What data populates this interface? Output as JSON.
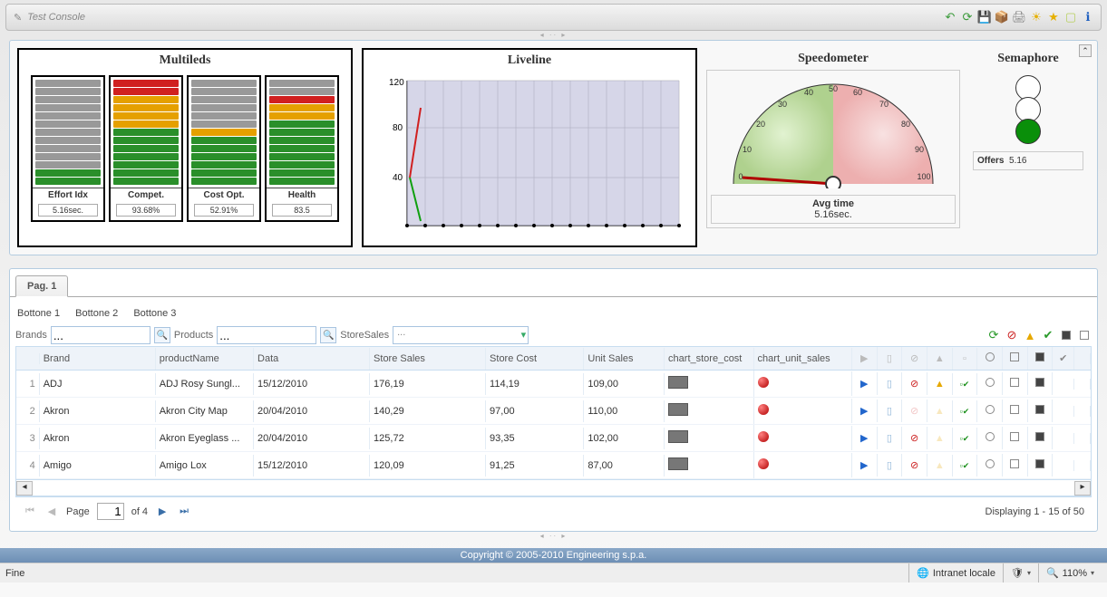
{
  "app_title": "Test Console",
  "dashboard": {
    "multileds": {
      "title": "Multileds",
      "cols": [
        {
          "label": "Effort Idx",
          "value": "5.16sec.",
          "colors": [
            "gray",
            "gray",
            "gray",
            "gray",
            "gray",
            "gray",
            "gray",
            "gray",
            "gray",
            "gray",
            "gray",
            "green",
            "green"
          ]
        },
        {
          "label": "Compet.",
          "value": "93.68%",
          "colors": [
            "red",
            "red",
            "orange",
            "orange",
            "orange",
            "orange",
            "green",
            "green",
            "green",
            "green",
            "green",
            "green",
            "green"
          ]
        },
        {
          "label": "Cost Opt.",
          "value": "52.91%",
          "colors": [
            "gray",
            "gray",
            "gray",
            "gray",
            "gray",
            "gray",
            "orange",
            "green",
            "green",
            "green",
            "green",
            "green",
            "green"
          ]
        },
        {
          "label": "Health",
          "value": "83.5",
          "colors": [
            "gray",
            "gray",
            "red",
            "orange",
            "orange",
            "green",
            "green",
            "green",
            "green",
            "green",
            "green",
            "green",
            "green"
          ]
        }
      ]
    },
    "liveline": {
      "title": "Liveline"
    },
    "speedometer": {
      "title": "Speedometer",
      "caption_b": "Avg time",
      "caption_v": "5.16sec."
    },
    "semaphore": {
      "title": "Semaphore",
      "label": "Offers",
      "value": "5.16"
    }
  },
  "tab_label": "Pag. 1",
  "buttons": [
    "Bottone 1",
    "Bottone 2",
    "Bottone 3"
  ],
  "filters": {
    "brands_label": "Brands",
    "brands_value": "...",
    "products_label": "Products",
    "products_value": "...",
    "storesales_label": "StoreSales",
    "storesales_value": "..."
  },
  "columns": {
    "brand": "Brand",
    "product": "productName",
    "data": "Data",
    "ss": "Store Sales",
    "sc": "Store Cost",
    "us": "Unit Sales",
    "csc": "chart_store_cost",
    "cus": "chart_unit_sales"
  },
  "rows": [
    {
      "n": "1",
      "brand": "ADJ",
      "product": "ADJ Rosy Sungl...",
      "data": "15/12/2010",
      "ss": "176,19",
      "sc": "114,19",
      "us": "109,00",
      "err": true,
      "warn": true
    },
    {
      "n": "2",
      "brand": "Akron",
      "product": "Akron City Map",
      "data": "20/04/2010",
      "ss": "140,29",
      "sc": "97,00",
      "us": "110,00",
      "err": false,
      "warn": false
    },
    {
      "n": "3",
      "brand": "Akron",
      "product": "Akron Eyeglass ...",
      "data": "20/04/2010",
      "ss": "125,72",
      "sc": "93,35",
      "us": "102,00",
      "err": true,
      "warn": false
    },
    {
      "n": "4",
      "brand": "Amigo",
      "product": "Amigo Lox",
      "data": "15/12/2010",
      "ss": "120,09",
      "sc": "91,25",
      "us": "87,00",
      "err": true,
      "warn": false
    }
  ],
  "paging": {
    "page_label": "Page",
    "page": "1",
    "of": "of 4",
    "display": "Displaying 1 - 15 of 50"
  },
  "copyright": "Copyright © 2005-2010 Engineering s.p.a.",
  "status": {
    "fine": "Fine",
    "zone": "Intranet locale",
    "zoom": "110%"
  },
  "chart_data": [
    {
      "type": "bar",
      "title": "Multileds",
      "series": [
        {
          "name": "Effort Idx",
          "value": "5.16sec.",
          "filled_segments": 2,
          "total_segments": 13
        },
        {
          "name": "Compet.",
          "value": 93.68,
          "filled_segments": 13,
          "total_segments": 13
        },
        {
          "name": "Cost Opt.",
          "value": 52.91,
          "filled_segments": 7,
          "total_segments": 13
        },
        {
          "name": "Health",
          "value": 83.5,
          "filled_segments": 11,
          "total_segments": 13
        }
      ]
    },
    {
      "type": "line",
      "title": "Liveline",
      "xlim": [
        0,
        16
      ],
      "ylim": [
        0,
        120
      ],
      "yticks": [
        40,
        80,
        120
      ],
      "series": [
        {
          "name": "red",
          "points": [
            [
              0,
              40
            ],
            [
              1,
              95
            ]
          ]
        },
        {
          "name": "green",
          "points": [
            [
              0,
              40
            ],
            [
              1,
              5
            ]
          ]
        }
      ]
    },
    {
      "type": "gauge",
      "title": "Speedometer",
      "label": "Avg time",
      "value": 5.16,
      "unit": "sec.",
      "min": 0,
      "max": 100,
      "ticks": [
        0,
        10,
        20,
        30,
        40,
        50,
        60,
        70,
        80,
        90,
        100
      ]
    },
    {
      "type": "indicator",
      "title": "Semaphore",
      "label": "Offers",
      "value": 5.16,
      "lights": [
        "off",
        "off",
        "green"
      ]
    }
  ]
}
